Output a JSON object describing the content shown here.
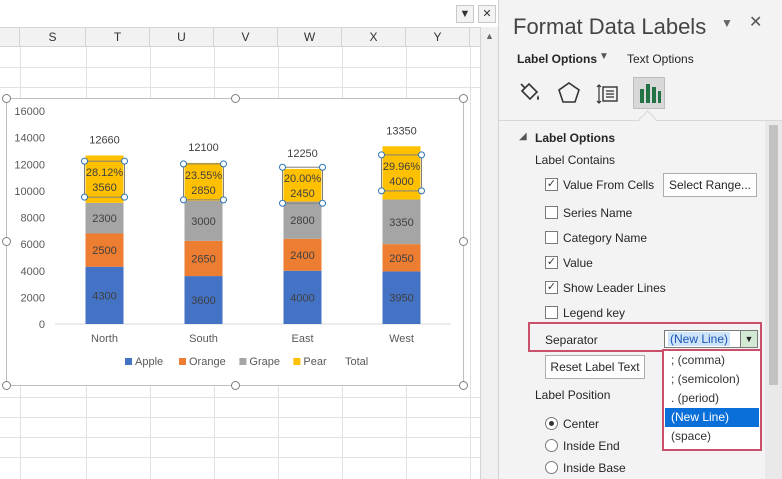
{
  "sheet": {
    "columns": [
      "S",
      "T",
      "U",
      "V",
      "W",
      "X",
      "Y"
    ],
    "dropdown_glyph": "▼",
    "close_glyph": "✕"
  },
  "chart_data": {
    "type": "bar",
    "stacked": true,
    "categories": [
      "North",
      "South",
      "East",
      "West"
    ],
    "series": [
      {
        "name": "Apple",
        "color": "#4472c4",
        "values": [
          4300,
          3600,
          4000,
          3950
        ]
      },
      {
        "name": "Orange",
        "color": "#ed7d31",
        "values": [
          2500,
          2650,
          2400,
          2050
        ]
      },
      {
        "name": "Grape",
        "color": "#a5a5a5",
        "values": [
          2300,
          3000,
          2800,
          3350
        ]
      },
      {
        "name": "Pear",
        "color": "#ffc000",
        "values": [
          3560,
          2850,
          2450,
          4000
        ]
      }
    ],
    "totals_series_name": "Total",
    "totals": [
      12660,
      12100,
      12250,
      13350
    ],
    "pear_percent_labels": [
      "28.12%",
      "23.55%",
      "20.00%",
      "29.96%"
    ],
    "ylim": [
      0,
      16000
    ],
    "yticks": [
      0,
      2000,
      4000,
      6000,
      8000,
      10000,
      12000,
      14000,
      16000
    ],
    "legend_position": "bottom"
  },
  "pane": {
    "title": "Format Data Labels",
    "ctrl_glyph": "▼",
    "close_glyph": "✕",
    "tabs": {
      "label_options": "Label Options",
      "chev": "▼",
      "text_options": "Text Options"
    },
    "icons": [
      "fill-line-icon",
      "effects-icon",
      "size-properties-icon",
      "label-options-icon"
    ],
    "section_triangle": "◢",
    "section_title": "Label Options",
    "label_contains": "Label Contains",
    "options": [
      {
        "name": "value-from-cells",
        "label": "Value From Cells",
        "checked": true
      },
      {
        "name": "series-name",
        "label": "Series Name",
        "checked": false
      },
      {
        "name": "category-name",
        "label": "Category Name",
        "checked": false
      },
      {
        "name": "value",
        "label": "Value",
        "checked": true
      },
      {
        "name": "show-leader-lines",
        "label": "Show Leader Lines",
        "checked": true
      },
      {
        "name": "legend-key",
        "label": "Legend key",
        "checked": false
      }
    ],
    "select_range": "Select Range...",
    "separator_label": "Separator",
    "separator_value": "(New Line)",
    "separator_arrow": "▼",
    "separator_options": [
      "; (comma)",
      "; (semicolon)",
      ". (period)",
      "(New Line)",
      "(space)"
    ],
    "separator_selected_index": 3,
    "reset_label_text": "Reset Label Text",
    "label_position": "Label Position",
    "positions": [
      {
        "label": "Center",
        "selected": true
      },
      {
        "label": "Inside End",
        "selected": false
      },
      {
        "label": "Inside Base",
        "selected": false
      }
    ],
    "check_glyph": "✓"
  }
}
